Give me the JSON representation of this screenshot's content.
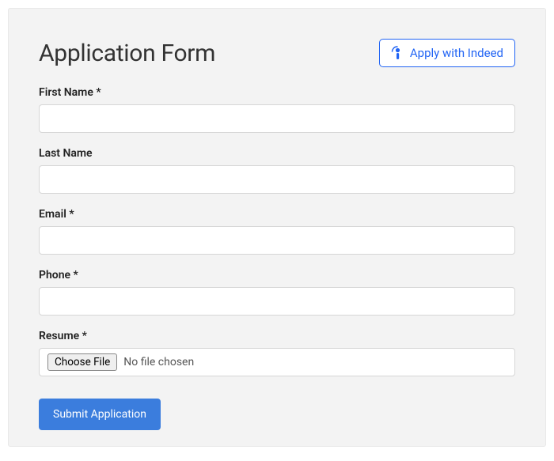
{
  "header": {
    "title": "Application Form",
    "apply_indeed_label": "Apply with Indeed"
  },
  "form": {
    "first_name": {
      "label": "First Name *",
      "value": ""
    },
    "last_name": {
      "label": "Last Name",
      "value": ""
    },
    "email": {
      "label": "Email *",
      "value": ""
    },
    "phone": {
      "label": "Phone *",
      "value": ""
    },
    "resume": {
      "label": "Resume *",
      "choose_file_label": "Choose File",
      "file_status": "No file chosen"
    },
    "submit_label": "Submit Application"
  }
}
